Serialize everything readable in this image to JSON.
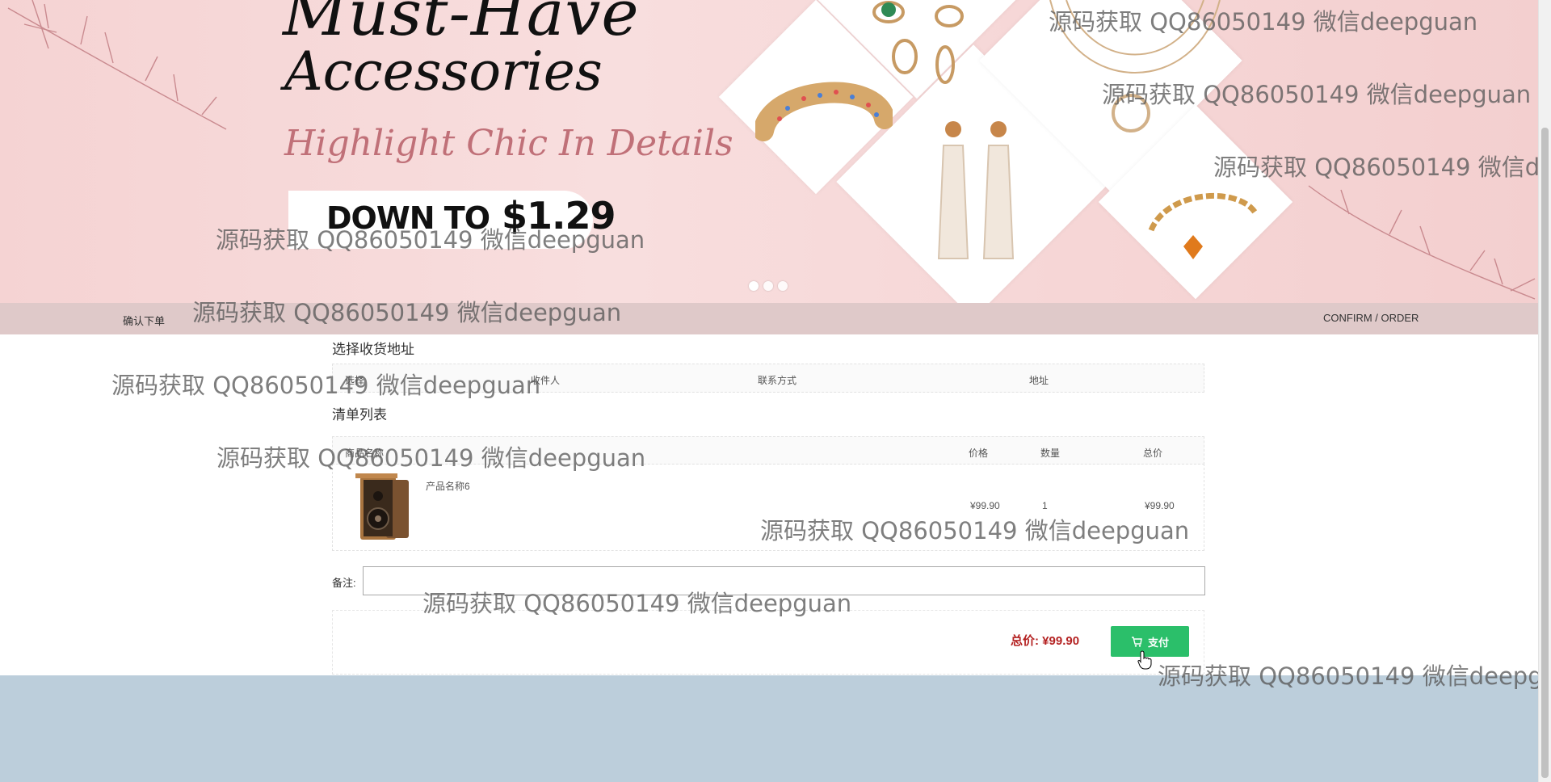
{
  "banner": {
    "headline_line1": "Must-Have",
    "headline_line2": "Accessories",
    "tagline": "Highlight Chic In Details",
    "price_prefix": "DOWN TO",
    "price_value": "$1.29",
    "slide_count": 3,
    "active_slide": 0
  },
  "confirm_bar": {
    "left_label": "确认下单",
    "right_label": "CONFIRM / ORDER"
  },
  "address_section": {
    "title": "选择收货地址",
    "columns": [
      "选择",
      "收件人",
      "联系方式",
      "地址"
    ]
  },
  "cart_section": {
    "title": "清单列表",
    "columns": [
      "商品名称",
      "价格",
      "数量",
      "总价"
    ],
    "items": [
      {
        "name": "产品名称6",
        "price": "¥99.90",
        "quantity": "1",
        "total": "¥99.90",
        "image_icon": "speaker-icon"
      }
    ]
  },
  "remark": {
    "label": "备注:",
    "value": "",
    "placeholder": ""
  },
  "payment": {
    "total_label": "总价:",
    "total_value": "¥99.90",
    "pay_button_label": "支付",
    "pay_icon": "cart-icon"
  },
  "watermark_text": "源码获取 QQ86050149 微信deepguan",
  "colors": {
    "banner_bg": "#f5d3d3",
    "confirm_bar_bg": "#dfc9c9",
    "pay_button_bg": "#2bbf6a",
    "total_price": "#b42222",
    "footer_bg": "#bccedb"
  }
}
